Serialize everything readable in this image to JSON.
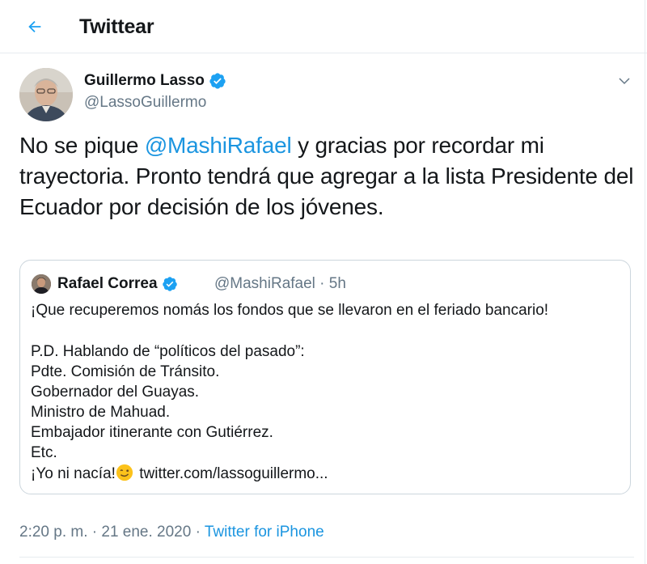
{
  "header": {
    "title": "Twittear"
  },
  "tweet": {
    "author_name": "Guillermo Lasso",
    "author_handle": "@LassoGuillermo",
    "text_mention": "@MashiRafael",
    "text_before": "No se pique ",
    "text_after": " y gracias por recordar mi trayectoria. Pronto tendrá que agregar a la lista Presidente del Ecuador por decisión de los jóvenes."
  },
  "quote": {
    "author_name": "Rafael Correa",
    "author_handle_time": "@MashiRafael · 5h",
    "lines": [
      "¡Que recuperemos nomás los fondos que se llevaron en el feriado bancario!",
      "",
      "P.D. Hablando de “políticos del pasado”:",
      "Pdte. Comisión de Tránsito.",
      "Gobernador del Guayas.",
      "Ministro de Mahuad.",
      "Embajador itinerante con Gutiérrez.",
      "Etc."
    ],
    "last_line_before": "¡Yo ni nacía!",
    "last_line_link": " twitter.com/lassoguillermo..."
  },
  "meta": {
    "timestamp": "2:20 p. m. · 21 ene. 2020",
    "separator": " · ",
    "source": "Twitter for iPhone"
  },
  "colors": {
    "accent": "#1b95e0",
    "verified": "#1da1f2",
    "muted": "#657786",
    "border": "#ccd6dd"
  },
  "icons": {
    "back": "back-arrow-icon",
    "verified": "verified-badge-icon",
    "caret": "chevron-down-icon",
    "emoji": "winking-face-emoji-icon"
  }
}
